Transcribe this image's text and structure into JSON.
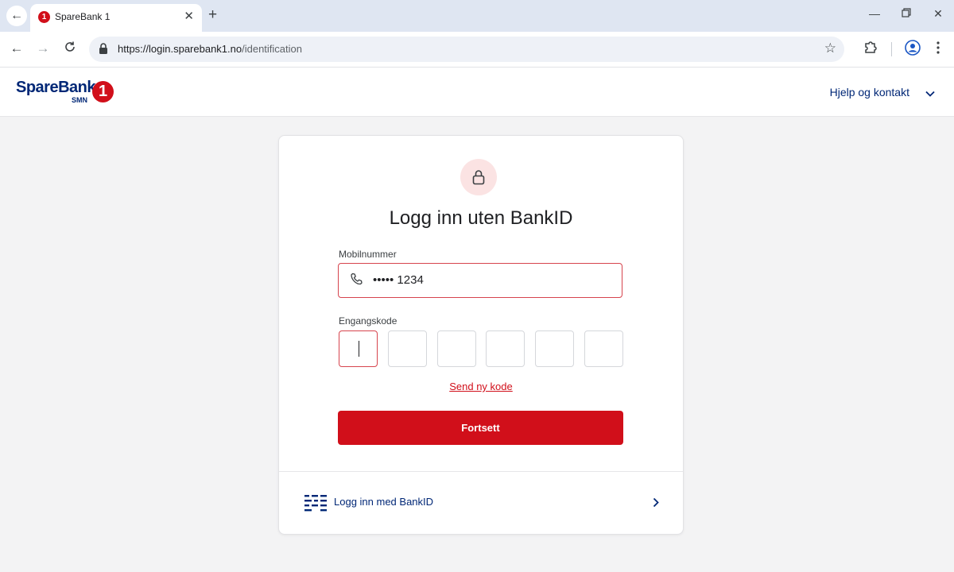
{
  "browser": {
    "tab_title": "SpareBank 1",
    "favicon_glyph": "1",
    "url_host": "https://login.sparebank1.no",
    "url_path": "/identification"
  },
  "header": {
    "logo_text": "SpareBank",
    "logo_sub": "SMN",
    "logo_badge": "1",
    "help_label": "Hjelp og kontakt"
  },
  "card": {
    "title": "Logg inn uten BankID",
    "phone_label": "Mobilnummer",
    "phone_value": "••••• 1234",
    "code_label": "Engangskode",
    "code_digits": [
      "",
      "",
      "",
      "",
      "",
      ""
    ],
    "resend_label": "Send ny kode",
    "continue_label": "Fortsett",
    "bankid_label": "Logg inn med BankID"
  },
  "colors": {
    "brand_red": "#d10f1a",
    "brand_navy": "#002776",
    "field_error_border": "#d6444d"
  },
  "icons": [
    "back-arrow-icon",
    "forward-arrow-icon",
    "reload-icon",
    "lock-icon",
    "star-icon",
    "extensions-icon",
    "profile-icon",
    "menu-icon",
    "chevron-down-icon",
    "phone-icon",
    "bankid-icon",
    "chevron-right-icon"
  ]
}
